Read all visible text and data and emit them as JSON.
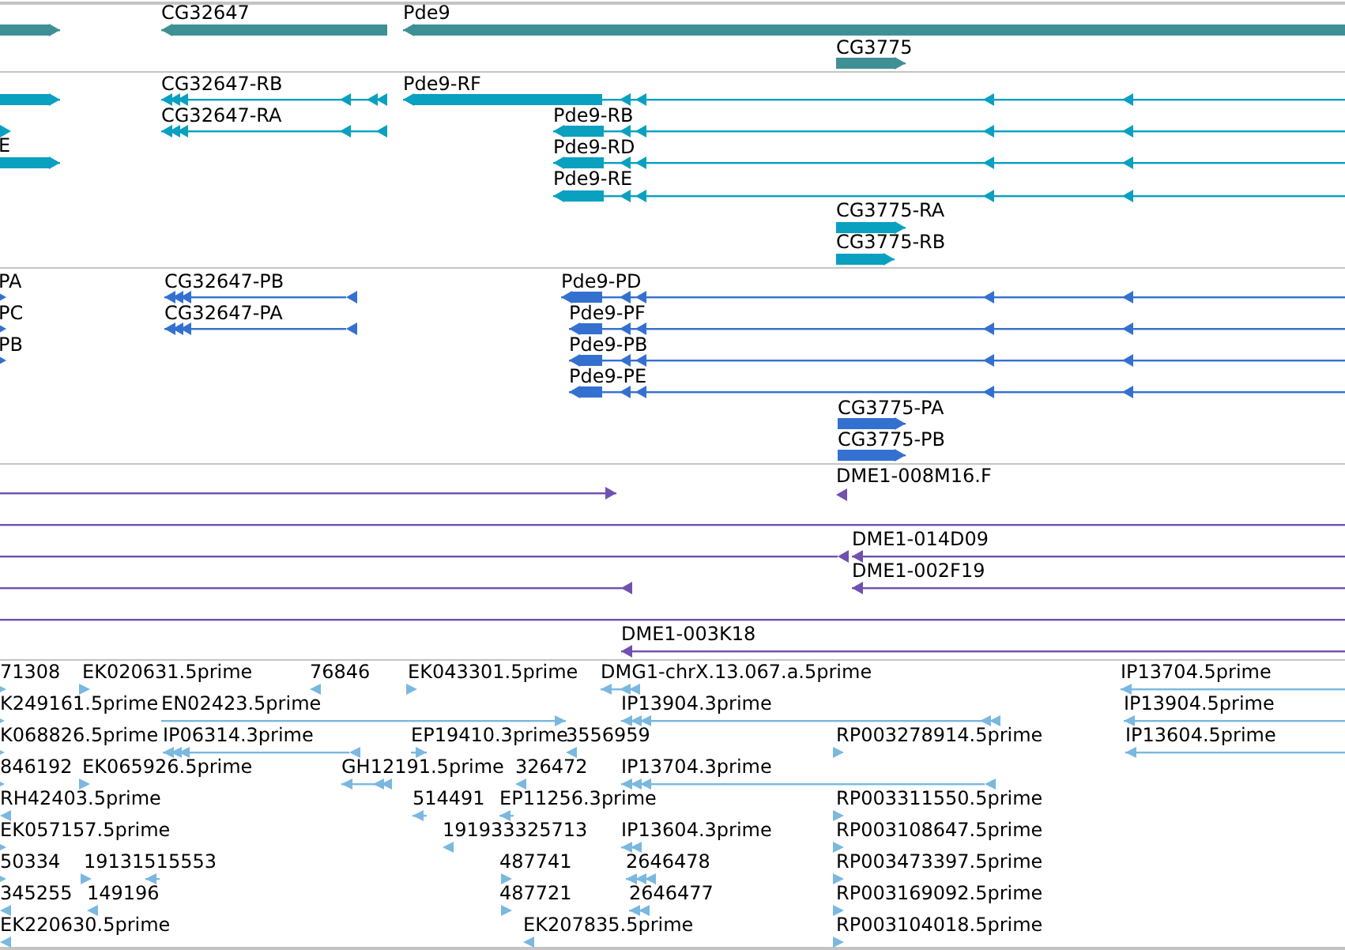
{
  "tracks": [
    {
      "color": "#3f9094",
      "features": [
        {
          "label": "CG32647"
        },
        {
          "label": "Pde9"
        },
        {
          "label": "CG3775"
        }
      ]
    },
    {
      "color": "#0aa0c0",
      "features": [
        {
          "label": "E"
        },
        {
          "label": "CG32647-RB"
        },
        {
          "label": "CG32647-RA"
        },
        {
          "label": "Pde9-RF"
        },
        {
          "label": "Pde9-RB"
        },
        {
          "label": "Pde9-RD"
        },
        {
          "label": "Pde9-RE"
        },
        {
          "label": "CG3775-RA"
        },
        {
          "label": "CG3775-RB"
        }
      ]
    },
    {
      "color": "#3470d0",
      "features": [
        {
          "label": "PA"
        },
        {
          "label": "PC"
        },
        {
          "label": "PB"
        },
        {
          "label": "CG32647-PB"
        },
        {
          "label": "CG32647-PA"
        },
        {
          "label": "Pde9-PD"
        },
        {
          "label": "Pde9-PF"
        },
        {
          "label": "Pde9-PB"
        },
        {
          "label": "Pde9-PE"
        },
        {
          "label": "CG3775-PA"
        },
        {
          "label": "CG3775-PB"
        }
      ]
    },
    {
      "color": "#7050b0",
      "features": [
        {
          "label": "DME1-008M16.F"
        },
        {
          "label": "DME1-014D09"
        },
        {
          "label": "DME1-002F19"
        },
        {
          "label": "DME1-003K18"
        }
      ]
    },
    {
      "color": "#7ab8e0",
      "features": [
        {
          "label": "71308"
        },
        {
          "label": "EK020631.5prime"
        },
        {
          "label": "76846"
        },
        {
          "label": "EK043301.5prime"
        },
        {
          "label": "DMG1-chrX.13.067.a.5prime"
        },
        {
          "label": "IP13704.5prime"
        },
        {
          "label": "K249161.5prime"
        },
        {
          "label": "EN02423.5prime"
        },
        {
          "label": "IP13904.3prime"
        },
        {
          "label": "IP13904.5prime"
        },
        {
          "label": "K068826.5prime"
        },
        {
          "label": "IP06314.3prime"
        },
        {
          "label": "EP19410.3prime"
        },
        {
          "label": "3556959"
        },
        {
          "label": "RP003278914.5prime"
        },
        {
          "label": "IP13604.5prime"
        },
        {
          "label": "846192"
        },
        {
          "label": "EK065926.5prime"
        },
        {
          "label": "GH12191.5prime"
        },
        {
          "label": "326472"
        },
        {
          "label": "IP13704.3prime"
        },
        {
          "label": "RH42403.5prime"
        },
        {
          "label": "514491"
        },
        {
          "label": "EP11256.3prime"
        },
        {
          "label": "RP003311550.5prime"
        },
        {
          "label": "EK057157.5prime"
        },
        {
          "label": "191933325713"
        },
        {
          "label": "IP13604.3prime"
        },
        {
          "label": "RP003108647.5prime"
        },
        {
          "label": "50334"
        },
        {
          "label": "19131515553"
        },
        {
          "label": "487741"
        },
        {
          "label": "2646478"
        },
        {
          "label": "RP003473397.5prime"
        },
        {
          "label": "345255"
        },
        {
          "label": "149196"
        },
        {
          "label": "487721"
        },
        {
          "label": "2646477"
        },
        {
          "label": "RP003169092.5prime"
        },
        {
          "label": "EK220630.5prime"
        },
        {
          "label": "EK207835.5prime"
        },
        {
          "label": "RP003104018.5prime"
        }
      ]
    }
  ]
}
